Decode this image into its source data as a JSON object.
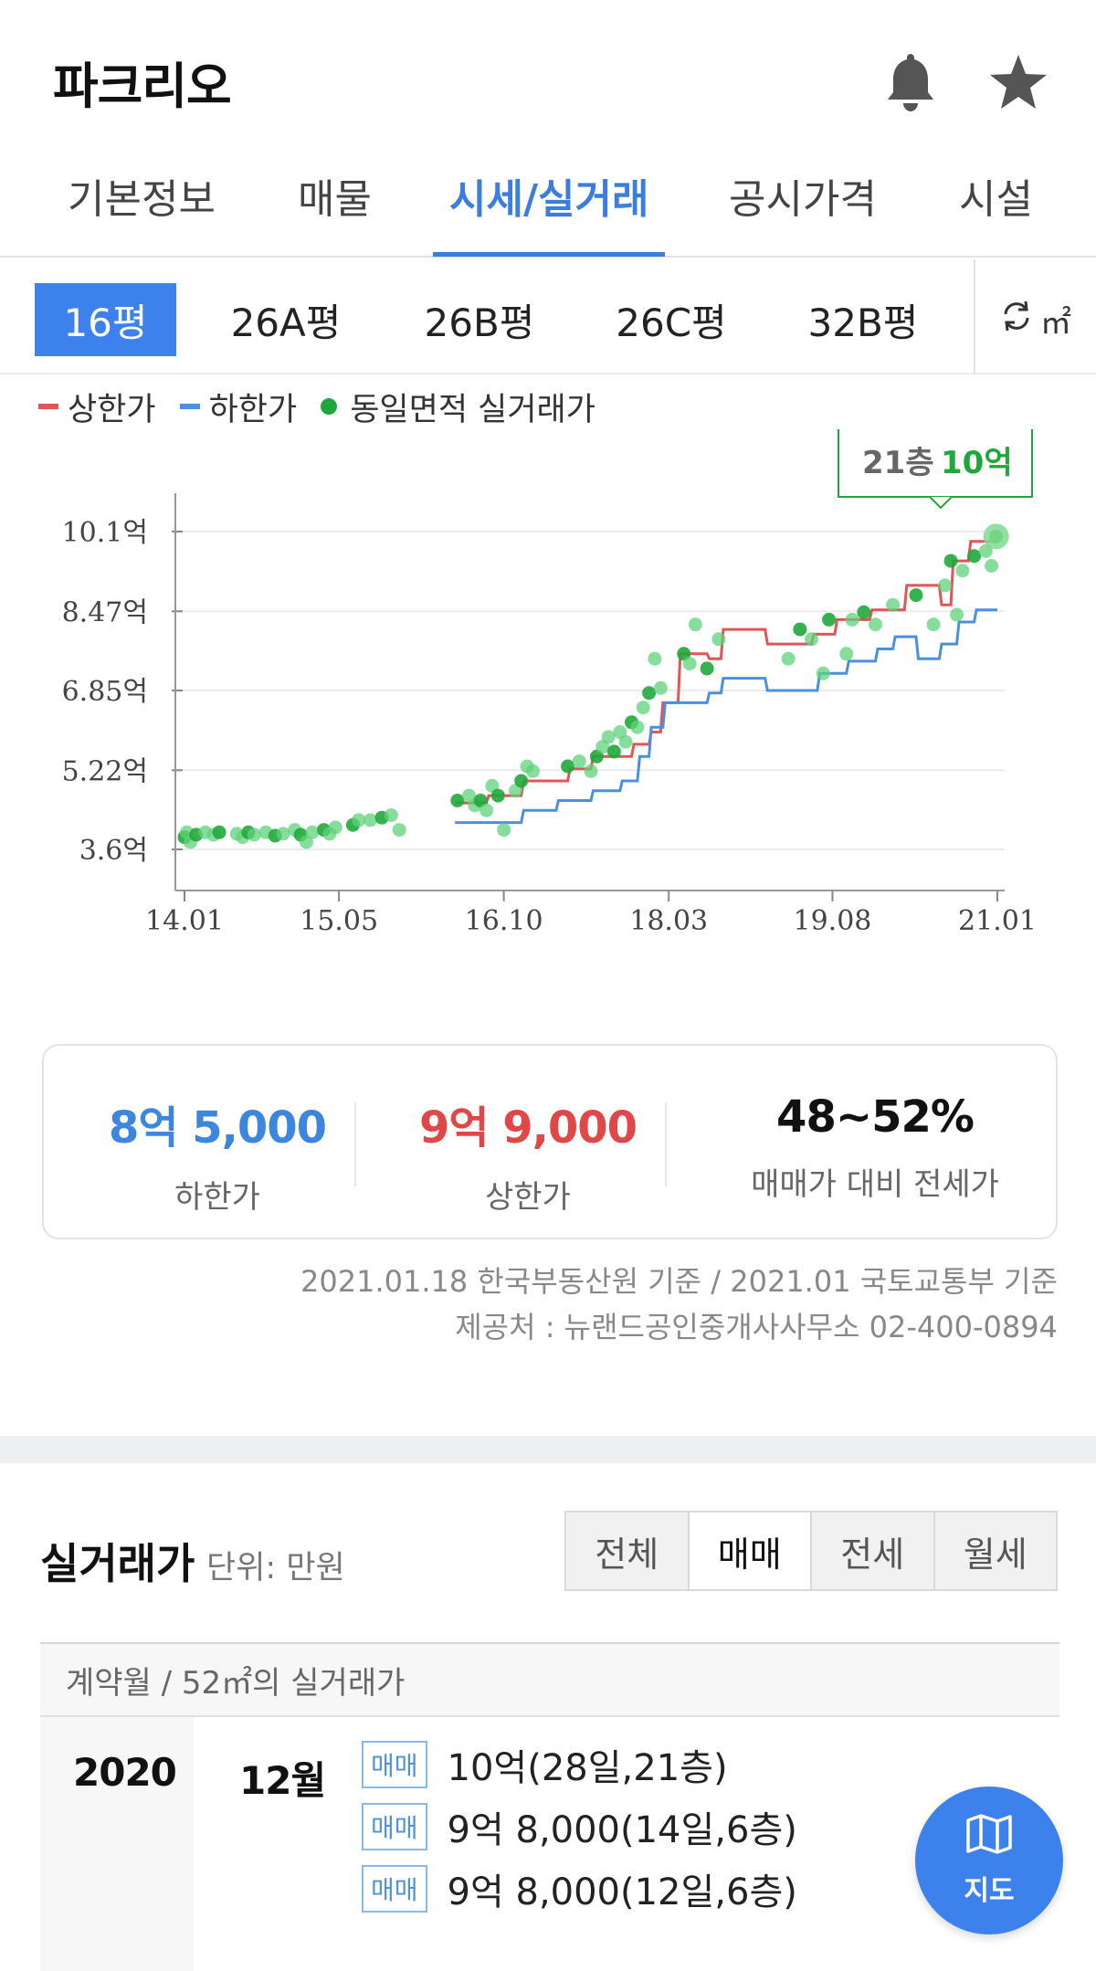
{
  "header": {
    "title": "파크리오",
    "bell_icon": "bell-icon",
    "star_icon": "star-icon"
  },
  "tabs": [
    {
      "label": "기본정보",
      "active": false
    },
    {
      "label": "매물",
      "active": false
    },
    {
      "label": "시세/실거래",
      "active": true
    },
    {
      "label": "공시가격",
      "active": false
    },
    {
      "label": "시설",
      "active": false
    }
  ],
  "size_tabs": [
    {
      "label": "16평",
      "active": true
    },
    {
      "label": "26A평",
      "active": false
    },
    {
      "label": "26B평",
      "active": false
    },
    {
      "label": "26C평",
      "active": false
    },
    {
      "label": "32B평",
      "active": false
    }
  ],
  "unit_toggle": {
    "label": "㎡",
    "icon": "refresh-icon"
  },
  "legend": [
    {
      "label": "상한가",
      "color": "#e05555",
      "kind": "line"
    },
    {
      "label": "하한가",
      "color": "#4a90e2",
      "kind": "line"
    },
    {
      "label": "동일면적 실거래가",
      "color": "#1fa83a",
      "kind": "dot"
    }
  ],
  "chart_data": {
    "type": "line",
    "y_ticks": [
      "10.1억",
      "8.47억",
      "6.85억",
      "5.22억",
      "3.6억"
    ],
    "x_ticks": [
      "14.01",
      "15.05",
      "16.10",
      "18.03",
      "19.08",
      "21.01"
    ],
    "ylim": [
      3.6,
      10.1
    ],
    "callout": {
      "floor": "21층",
      "price": "10억"
    },
    "series": [
      {
        "name": "상한가",
        "color": "#e05555",
        "points": [
          [
            2016.33,
            4.55
          ],
          [
            2016.6,
            4.55
          ],
          [
            2016.62,
            4.7
          ],
          [
            2016.9,
            4.7
          ],
          [
            2016.92,
            5.0
          ],
          [
            2017.3,
            5.0
          ],
          [
            2017.32,
            5.25
          ],
          [
            2017.5,
            5.25
          ],
          [
            2017.52,
            5.5
          ],
          [
            2017.85,
            5.5
          ],
          [
            2017.87,
            5.75
          ],
          [
            2018.0,
            5.75
          ],
          [
            2018.02,
            6.0
          ],
          [
            2018.1,
            6.0
          ],
          [
            2018.12,
            6.6
          ],
          [
            2018.25,
            6.6
          ],
          [
            2018.27,
            7.6
          ],
          [
            2018.5,
            7.6
          ],
          [
            2018.52,
            7.5
          ],
          [
            2018.62,
            7.5
          ],
          [
            2018.64,
            8.1
          ],
          [
            2019.0,
            8.1
          ],
          [
            2019.02,
            7.8
          ],
          [
            2019.4,
            7.8
          ],
          [
            2019.42,
            8.0
          ],
          [
            2019.6,
            8.0
          ],
          [
            2019.62,
            8.3
          ],
          [
            2019.9,
            8.3
          ],
          [
            2019.92,
            8.5
          ],
          [
            2020.2,
            8.5
          ],
          [
            2020.22,
            9.0
          ],
          [
            2020.5,
            9.0
          ],
          [
            2020.52,
            8.6
          ],
          [
            2020.6,
            8.6
          ],
          [
            2020.62,
            9.5
          ],
          [
            2020.75,
            9.5
          ],
          [
            2020.77,
            9.9
          ],
          [
            2021.0,
            9.9
          ]
        ]
      },
      {
        "name": "하한가",
        "color": "#4a90e2",
        "points": [
          [
            2016.33,
            4.15
          ],
          [
            2016.9,
            4.15
          ],
          [
            2016.92,
            4.4
          ],
          [
            2017.2,
            4.4
          ],
          [
            2017.22,
            4.6
          ],
          [
            2017.5,
            4.6
          ],
          [
            2017.52,
            4.8
          ],
          [
            2017.75,
            4.8
          ],
          [
            2017.77,
            5.0
          ],
          [
            2017.9,
            5.0
          ],
          [
            2017.92,
            5.5
          ],
          [
            2018.0,
            5.5
          ],
          [
            2018.02,
            6.1
          ],
          [
            2018.12,
            6.1
          ],
          [
            2018.14,
            6.6
          ],
          [
            2018.5,
            6.6
          ],
          [
            2018.52,
            6.8
          ],
          [
            2018.62,
            6.8
          ],
          [
            2018.64,
            7.1
          ],
          [
            2019.0,
            7.1
          ],
          [
            2019.02,
            6.85
          ],
          [
            2019.45,
            6.85
          ],
          [
            2019.47,
            7.2
          ],
          [
            2019.7,
            7.2
          ],
          [
            2019.72,
            7.45
          ],
          [
            2019.95,
            7.45
          ],
          [
            2019.97,
            7.7
          ],
          [
            2020.1,
            7.7
          ],
          [
            2020.12,
            7.95
          ],
          [
            2020.3,
            7.95
          ],
          [
            2020.32,
            7.5
          ],
          [
            2020.5,
            7.5
          ],
          [
            2020.52,
            7.8
          ],
          [
            2020.65,
            7.8
          ],
          [
            2020.67,
            8.25
          ],
          [
            2020.8,
            8.25
          ],
          [
            2020.82,
            8.5
          ],
          [
            2021.0,
            8.5
          ]
        ]
      },
      {
        "name": "동일면적 실거래가",
        "color": "#1fa83a",
        "points": [
          [
            2014.0,
            3.85
          ],
          [
            2014.02,
            3.95
          ],
          [
            2014.05,
            3.75
          ],
          [
            2014.1,
            3.9
          ],
          [
            2014.18,
            3.95
          ],
          [
            2014.25,
            3.9
          ],
          [
            2014.3,
            3.95
          ],
          [
            2014.45,
            3.92
          ],
          [
            2014.5,
            3.85
          ],
          [
            2014.55,
            3.95
          ],
          [
            2014.6,
            3.9
          ],
          [
            2014.7,
            3.95
          ],
          [
            2014.78,
            3.88
          ],
          [
            2014.85,
            3.92
          ],
          [
            2014.95,
            4.0
          ],
          [
            2015.0,
            3.9
          ],
          [
            2015.05,
            3.75
          ],
          [
            2015.1,
            3.95
          ],
          [
            2015.2,
            4.0
          ],
          [
            2015.25,
            3.92
          ],
          [
            2015.3,
            4.05
          ],
          [
            2015.45,
            4.1
          ],
          [
            2015.5,
            4.2
          ],
          [
            2015.6,
            4.2
          ],
          [
            2015.7,
            4.25
          ],
          [
            2015.78,
            4.3
          ],
          [
            2015.85,
            4.0
          ],
          [
            2016.35,
            4.6
          ],
          [
            2016.45,
            4.7
          ],
          [
            2016.5,
            4.5
          ],
          [
            2016.55,
            4.6
          ],
          [
            2016.6,
            4.4
          ],
          [
            2016.65,
            4.9
          ],
          [
            2016.7,
            4.7
          ],
          [
            2016.75,
            4.0
          ],
          [
            2016.85,
            4.8
          ],
          [
            2016.9,
            5.0
          ],
          [
            2016.95,
            5.3
          ],
          [
            2017.0,
            5.2
          ],
          [
            2017.3,
            5.3
          ],
          [
            2017.4,
            5.4
          ],
          [
            2017.5,
            5.2
          ],
          [
            2017.55,
            5.5
          ],
          [
            2017.6,
            5.7
          ],
          [
            2017.65,
            5.9
          ],
          [
            2017.7,
            5.6
          ],
          [
            2017.75,
            6.0
          ],
          [
            2017.8,
            5.8
          ],
          [
            2017.85,
            6.2
          ],
          [
            2017.9,
            6.1
          ],
          [
            2017.95,
            6.5
          ],
          [
            2018.0,
            6.8
          ],
          [
            2018.05,
            7.5
          ],
          [
            2018.1,
            6.9
          ],
          [
            2018.3,
            7.6
          ],
          [
            2018.35,
            7.4
          ],
          [
            2018.4,
            8.2
          ],
          [
            2018.5,
            7.3
          ],
          [
            2018.6,
            7.9
          ],
          [
            2019.2,
            7.5
          ],
          [
            2019.3,
            8.1
          ],
          [
            2019.4,
            7.9
          ],
          [
            2019.5,
            7.2
          ],
          [
            2019.55,
            8.3
          ],
          [
            2019.7,
            7.6
          ],
          [
            2019.75,
            8.3
          ],
          [
            2019.85,
            8.45
          ],
          [
            2019.95,
            8.2
          ],
          [
            2020.1,
            8.6
          ],
          [
            2020.3,
            8.8
          ],
          [
            2020.45,
            8.2
          ],
          [
            2020.55,
            9.0
          ],
          [
            2020.6,
            9.5
          ],
          [
            2020.65,
            8.4
          ],
          [
            2020.7,
            9.3
          ],
          [
            2020.8,
            9.6
          ],
          [
            2020.9,
            9.7
          ],
          [
            2020.95,
            9.4
          ],
          [
            2020.99,
            10.0
          ]
        ]
      }
    ]
  },
  "summary": [
    {
      "value": "8억 5,000",
      "label": "하한가",
      "color": "#3d86e0"
    },
    {
      "value": "9억 9,000",
      "label": "상한가",
      "color": "#e04848"
    },
    {
      "value": "48~52%",
      "label": "매매가 대비 전세가",
      "color": "#111111"
    }
  ],
  "source": {
    "line1": "2021.01.18 한국부동산원 기준 / 2021.01 국토교통부 기준",
    "line2": "제공처 : 뉴랜드공인중개사사무소 02-400-0894"
  },
  "transactions": {
    "title": "실거래가",
    "unit": "단위: 만원",
    "filters": [
      {
        "label": "전체",
        "active": false
      },
      {
        "label": "매매",
        "active": true
      },
      {
        "label": "전세",
        "active": false
      },
      {
        "label": "월세",
        "active": false
      }
    ],
    "table_header": "계약월 / 52㎡의 실거래가",
    "year": "2020",
    "month": "12월",
    "deals": [
      {
        "type": "매매",
        "text": "10억(28일,21층)"
      },
      {
        "type": "매매",
        "text": "9억 8,000(14일,6층)"
      },
      {
        "type": "매매",
        "text": "9억 8,000(12일,6층)"
      }
    ]
  },
  "fab": {
    "label": "지도",
    "icon": "map-icon"
  }
}
